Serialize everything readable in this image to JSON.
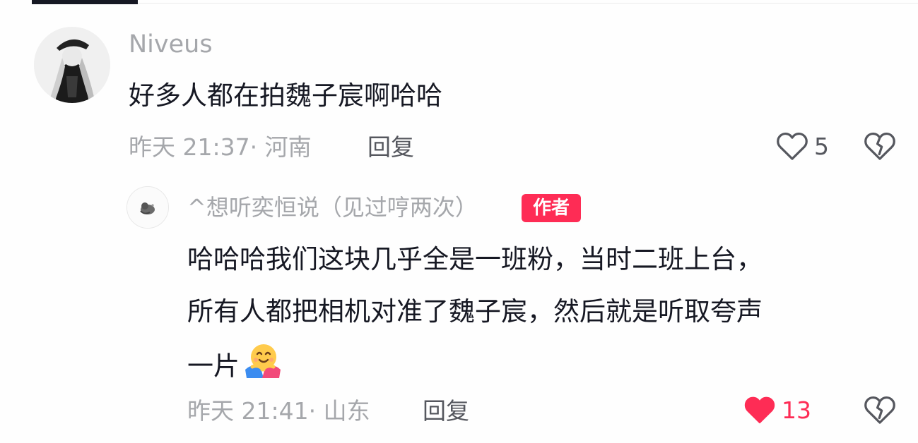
{
  "comment": {
    "username": "Niveus",
    "text": "好多人都在拍魏子宸啊哈哈",
    "time_location": "昨天 21:37· 河南",
    "reply_label": "回复",
    "likes": "5",
    "liked": false
  },
  "reply": {
    "username": "^想听奕恒说（见过哼两次）",
    "badge": "作者",
    "text_line1": "哈哈哈我们这块几乎全是一班粉，当时二班上台，",
    "text_line2": "所有人都把相机对准了魏子宸，然后就是听取夸声",
    "text_line3": "一片",
    "emoji": "smiling-face-with-open-hands",
    "time_location": "昨天 21:41· 山东",
    "reply_label": "回复",
    "likes": "13",
    "liked": true
  },
  "colors": {
    "like_active": "#fe2c55",
    "muted_text": "#a5a7ab",
    "primary_text": "#161823"
  }
}
